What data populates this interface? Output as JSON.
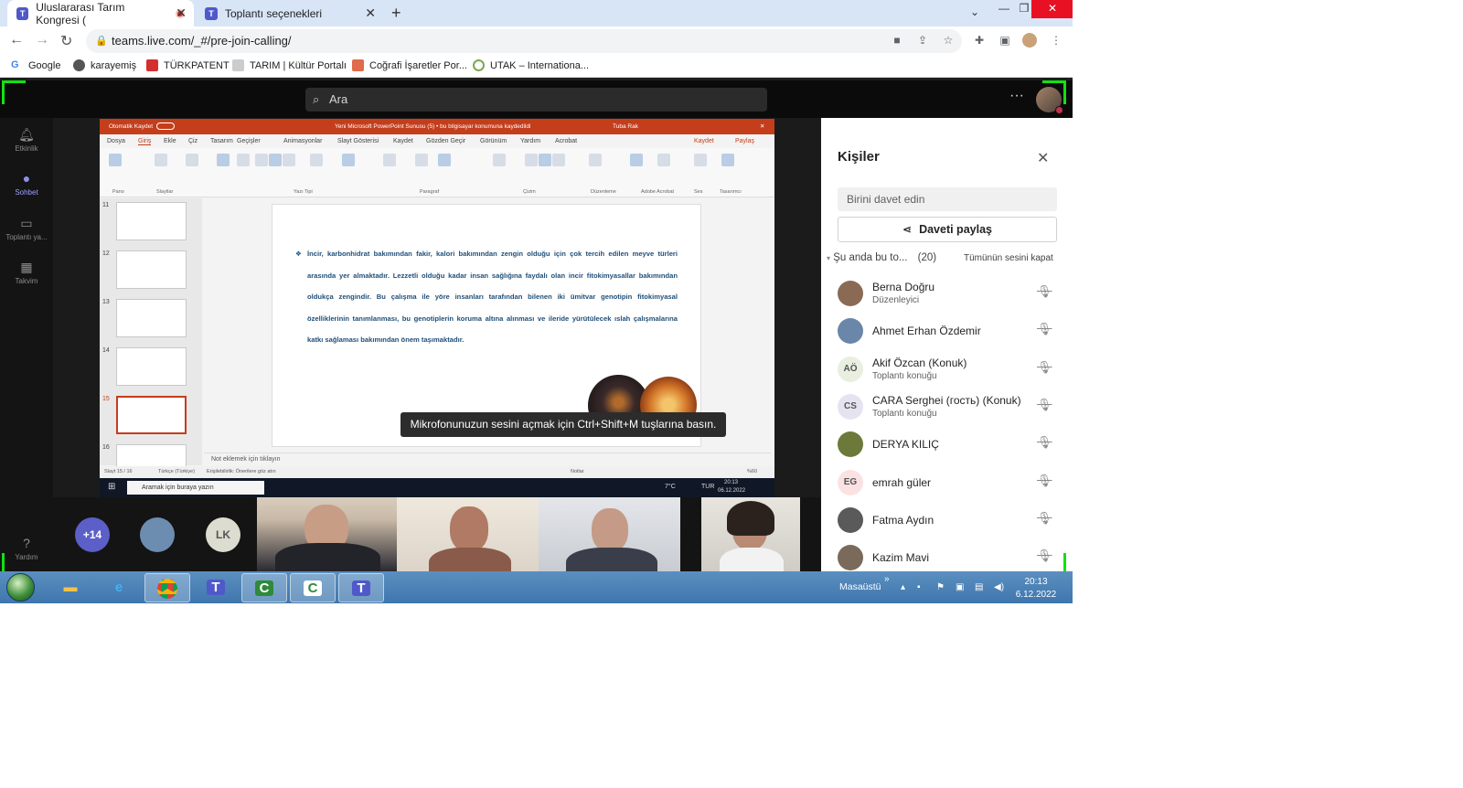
{
  "browser": {
    "tabs": [
      {
        "label": "Uluslararası Tarım Kongresi (",
        "active": true
      },
      {
        "label": "Toplantı seçenekleri",
        "active": false
      }
    ],
    "new_tab": "+",
    "url": "teams.live.com/_#/pre-join-calling/",
    "bookmarks": [
      "Google",
      "karayemiş",
      "TÜRKPATENT",
      "TARIM | Kültür Portalı",
      "Coğrafi İşaretler Por...",
      "UTAK – Internationa..."
    ]
  },
  "teams": {
    "search_placeholder": "Ara",
    "more": "···",
    "rail": [
      {
        "label": "Etkinlik",
        "icon": "bell-icon"
      },
      {
        "label": "Sohbet",
        "icon": "chat-icon"
      },
      {
        "label": "Toplantı ya...",
        "icon": "camera-icon"
      },
      {
        "label": "Takvim",
        "icon": "calendar-icon"
      },
      {
        "label": "Yardım",
        "icon": "help-icon"
      }
    ],
    "toast": "Mikrofonunuzun sesini açmak için Ctrl+Shift+M tuşlarına basın.",
    "strip": {
      "overflow": "+14",
      "initials": "LK"
    }
  },
  "ppt": {
    "title": "Yeni Microsoft PowerPoint Sunusu (5) • bu bilgisayar konumuna kaydedildi",
    "autosave": "Otomatik Kaydet",
    "user": "Tuba Rak",
    "menu": [
      "Dosya",
      "Giriş",
      "Ekle",
      "Çiz",
      "Tasarım",
      "Geçişler",
      "Animasyonlar",
      "Slayt Gösterisi",
      "Kaydet",
      "Gözden Geçir",
      "Görünüm",
      "Yardım",
      "Acrobat"
    ],
    "save_btn": "Kaydet",
    "share_btn": "Paylaş",
    "groups": [
      "Pano",
      "Slaytlar",
      "Yazı Tipi",
      "Paragraf",
      "Çizim",
      "Düzenleme",
      "Adobe Acrobat",
      "Ses",
      "Tasarımcı"
    ],
    "slide_numbers": [
      "11",
      "12",
      "13",
      "14",
      "15",
      "16"
    ],
    "slide_text": "İncir, karbonhidrat bakımından fakir, kalori bakımından zengin olduğu için çok tercih edilen meyve türleri arasında yer almaktadır. Lezzetli olduğu kadar insan sağlığına faydalı olan incir fitokimyasallar bakımından oldukça zengindir. Bu çalışma ile yöre insanları tarafından bilenen iki ümitvar genotipin fitokimyasal özelliklerinin tanımlanması, bu genotiplerin koruma altına alınması ve ileride yürütülecek ıslah çalışmalarına katkı sağlaması bakımından önem taşımaktadır.",
    "notes": "Not eklemek için tıklayın",
    "status_left": "Slayt 15 / 16",
    "status_lang": "Türkçe (Türkiye)",
    "status_access": "Erişilebilirlik: Önerilere göz atın",
    "status_notes": "Notlar",
    "zoom": "%60"
  },
  "inner_taskbar": {
    "search": "Aramak için buraya yazın",
    "weather": "7°C",
    "lang": "TUR",
    "time": "20:13",
    "date": "06.12.2022"
  },
  "people": {
    "title": "Kişiler",
    "invite_placeholder": "Birini davet edin",
    "share_label": "Daveti paylaş",
    "section": "Şu anda bu to...",
    "count": "(20)",
    "mute_all": "Tümünün sesini kapat",
    "participants": [
      {
        "name": "Berna Doğru",
        "role": "Düzenleyici",
        "initials": "",
        "bg": "#8a6a55"
      },
      {
        "name": "Ahmet Erhan Özdemir",
        "role": "",
        "initials": "",
        "bg": "#6a86a8"
      },
      {
        "name": "Akif Özcan (Konuk)",
        "role": "Toplantı konuğu",
        "initials": "AÖ",
        "bg": "#e8efe0"
      },
      {
        "name": "CARA Serghei (гость) (Konuk)",
        "role": "Toplantı konuğu",
        "initials": "CS",
        "bg": "#e6e3f1"
      },
      {
        "name": "DERYA KILIÇ",
        "role": "",
        "initials": "",
        "bg": "#6b7a3a"
      },
      {
        "name": "emrah güler",
        "role": "",
        "initials": "EG",
        "bg": "#fbe2e2"
      },
      {
        "name": "Fatma Aydın",
        "role": "",
        "initials": "",
        "bg": "#5a5a5a"
      },
      {
        "name": "Kazim Mavi",
        "role": "",
        "initials": "",
        "bg": "#7a6a5a"
      }
    ]
  },
  "taskbar": {
    "desktop": "Masaüstü",
    "time": "20:13",
    "date": "6.12.2022"
  }
}
